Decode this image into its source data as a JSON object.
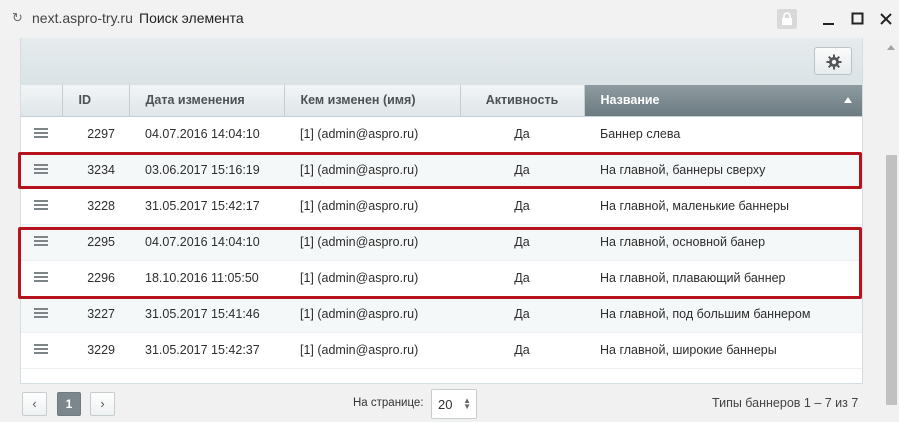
{
  "window": {
    "url": "next.aspro-try.ru",
    "title": "Поиск элемента"
  },
  "table": {
    "columns": [
      "ID",
      "Дата изменения",
      "Кем изменен (имя)",
      "Активность",
      "Название"
    ],
    "sorted_column": "Название",
    "rows": [
      {
        "id": "2297",
        "date": "04.07.2016 14:04:10",
        "user": "[1] (admin@aspro.ru)",
        "active": "Да",
        "name": "Баннер слева"
      },
      {
        "id": "3234",
        "date": "03.06.2017 15:16:19",
        "user": "[1] (admin@aspro.ru)",
        "active": "Да",
        "name": "На главной, баннеры сверху"
      },
      {
        "id": "3228",
        "date": "31.05.2017 15:42:17",
        "user": "[1] (admin@aspro.ru)",
        "active": "Да",
        "name": "На главной, маленькие баннеры"
      },
      {
        "id": "2295",
        "date": "04.07.2016 14:04:10",
        "user": "[1] (admin@aspro.ru)",
        "active": "Да",
        "name": "На главной, основной банер"
      },
      {
        "id": "2296",
        "date": "18.10.2016 11:05:50",
        "user": "[1] (admin@aspro.ru)",
        "active": "Да",
        "name": "На главной, плавающий баннер"
      },
      {
        "id": "3227",
        "date": "31.05.2017 15:41:46",
        "user": "[1] (admin@aspro.ru)",
        "active": "Да",
        "name": "На главной, под большим баннером"
      },
      {
        "id": "3229",
        "date": "31.05.2017 15:42:37",
        "user": "[1] (admin@aspro.ru)",
        "active": "Да",
        "name": "На главной, широкие баннеры"
      }
    ]
  },
  "pagination": {
    "prev": "‹",
    "current_page": "1",
    "next": "›",
    "per_page_label": "На странице:",
    "per_page_value": "20",
    "total": "Типы баннеров 1 – 7 из 7"
  },
  "colors": {
    "highlight": "#b5141e",
    "active_header": "#7b8a90"
  }
}
